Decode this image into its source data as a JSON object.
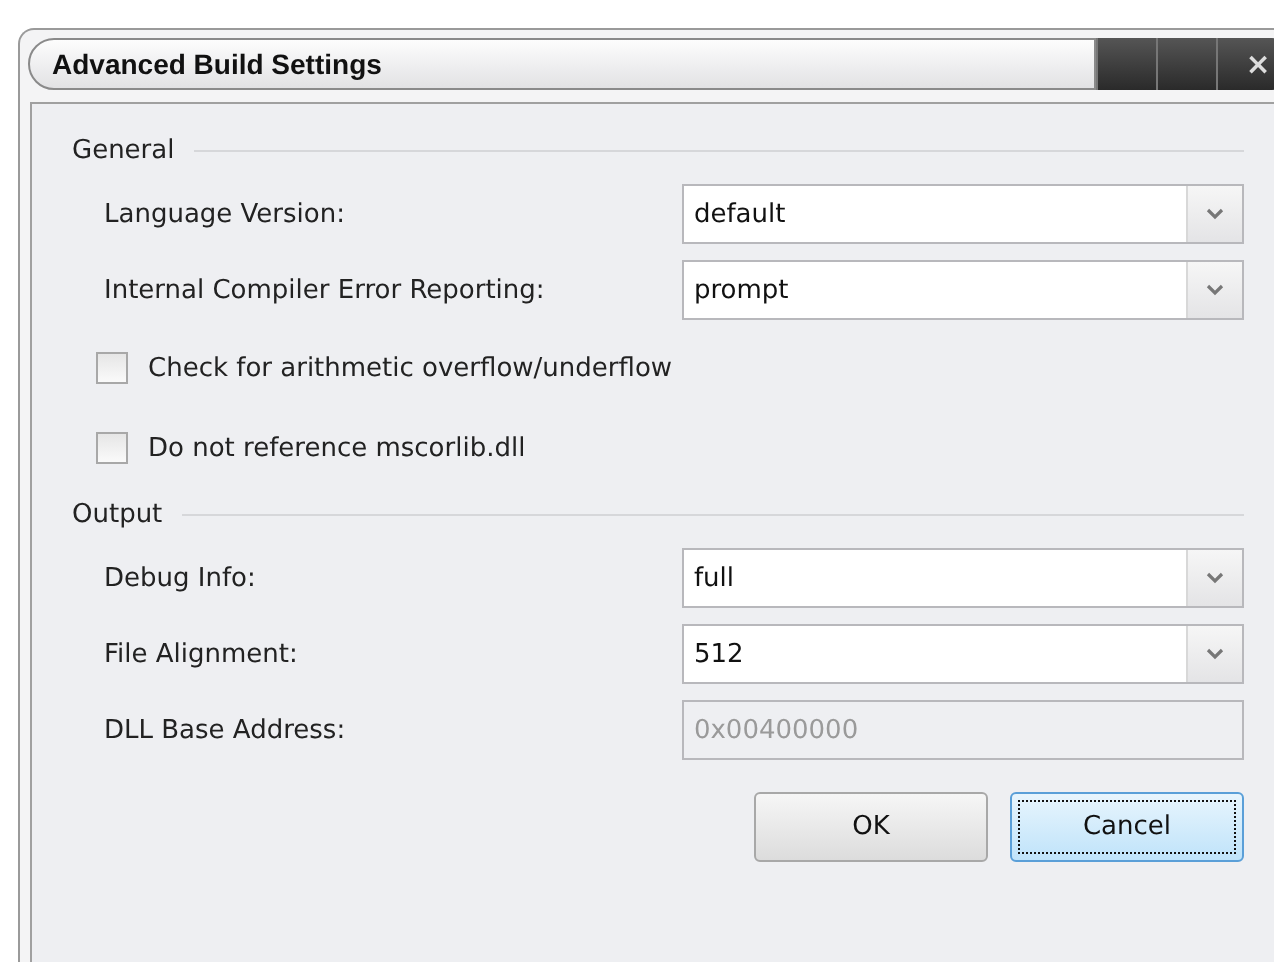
{
  "window": {
    "title": "Advanced Build Settings",
    "close": "×"
  },
  "sections": [
    {
      "title": "General",
      "items": [
        {
          "kind": "combo",
          "label": "Language Version:",
          "value": "default"
        },
        {
          "kind": "combo",
          "label": "Internal Compiler Error Reporting:",
          "value": "prompt"
        },
        {
          "kind": "checkbox",
          "label": "Check for arithmetic overflow/underflow",
          "checked": false
        },
        {
          "kind": "checkbox",
          "label": "Do not reference mscorlib.dll",
          "checked": false
        }
      ]
    },
    {
      "title": "Output",
      "items": [
        {
          "kind": "combo",
          "label": "Debug Info:",
          "value": "full"
        },
        {
          "kind": "combo",
          "label": "File Alignment:",
          "value": "512"
        },
        {
          "kind": "text",
          "label": "DLL Base Address:",
          "value": "0x00400000",
          "disabled": true
        }
      ]
    }
  ],
  "buttons": [
    {
      "label": "OK",
      "focused": false
    },
    {
      "label": "Cancel",
      "focused": true
    }
  ]
}
